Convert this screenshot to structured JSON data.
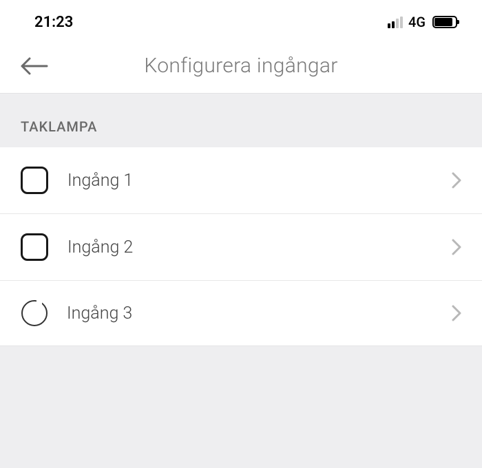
{
  "statusBar": {
    "time": "21:23",
    "networkType": "4G"
  },
  "header": {
    "title": "Konfigurera ingångar"
  },
  "section": {
    "label": "TAKLAMPA"
  },
  "items": [
    {
      "label": "Ingång 1",
      "shape": "square"
    },
    {
      "label": "Ingång 2",
      "shape": "square"
    },
    {
      "label": "Ingång 3",
      "shape": "circle"
    }
  ]
}
